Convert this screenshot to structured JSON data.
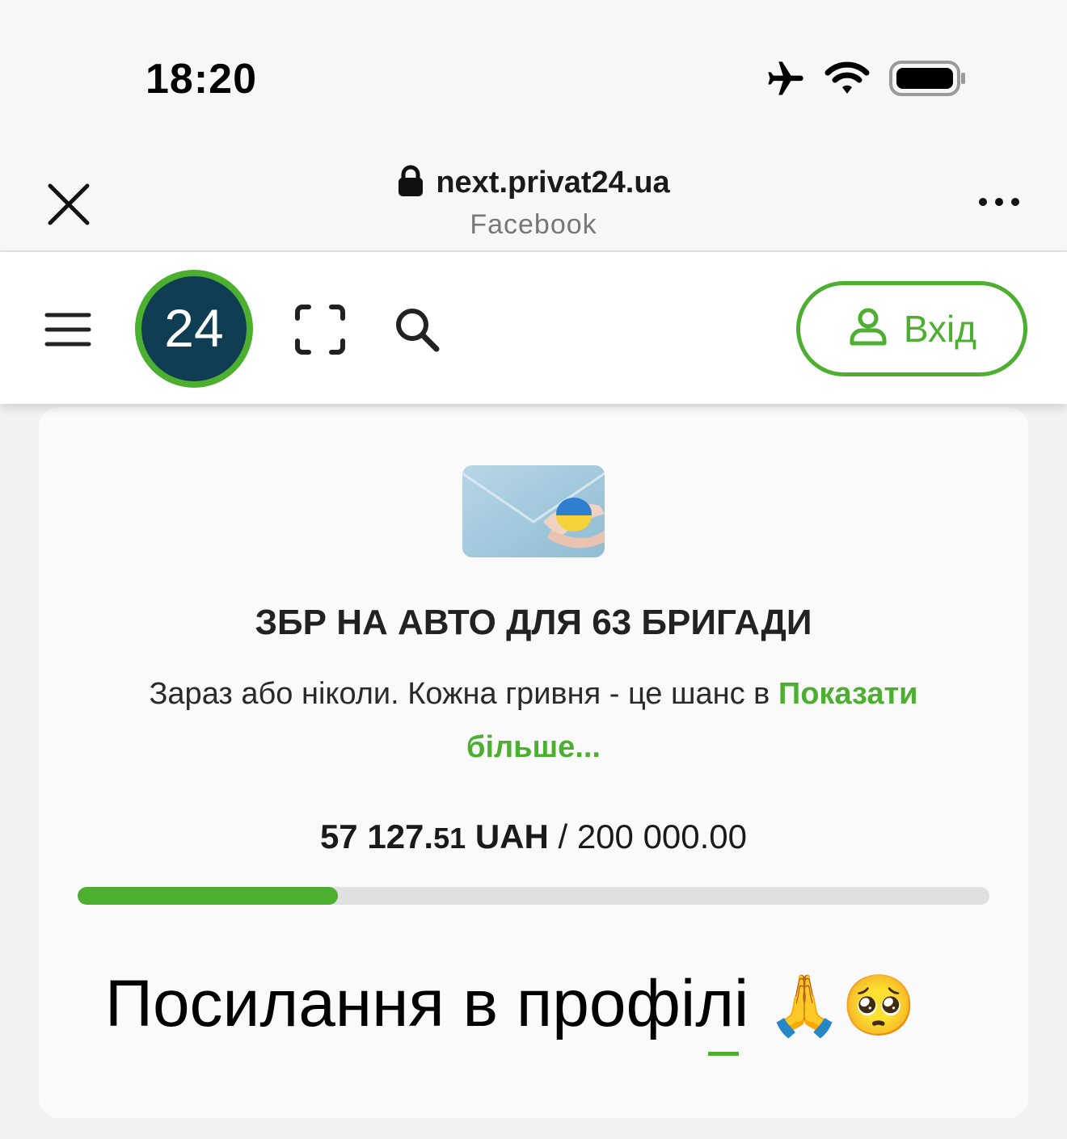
{
  "status_bar": {
    "time": "18:20",
    "icons": [
      "airplane-icon",
      "wifi-icon",
      "battery-icon"
    ]
  },
  "browser": {
    "url": "next.privat24.ua",
    "source": "Facebook"
  },
  "header": {
    "logo_text": "24",
    "login_label": "Вхід"
  },
  "fundraiser": {
    "title": "ЗБР НА АВТО ДЛЯ 63 БРИГАДИ",
    "description": "Зараз або ніколи. Кожна гривня - це шанс в",
    "show_more": "Показати більше...",
    "raised_main": "57 127.",
    "raised_cents": "51",
    "currency": "UAH",
    "goal": "/ 200 000.00",
    "progress_fraction": 0.2856
  },
  "overlay_caption": {
    "text": "Посилання в профілі",
    "emoji": "🙏🥺"
  },
  "colors": {
    "accent": "#4caf30",
    "logo_bg": "#0e3d54"
  }
}
